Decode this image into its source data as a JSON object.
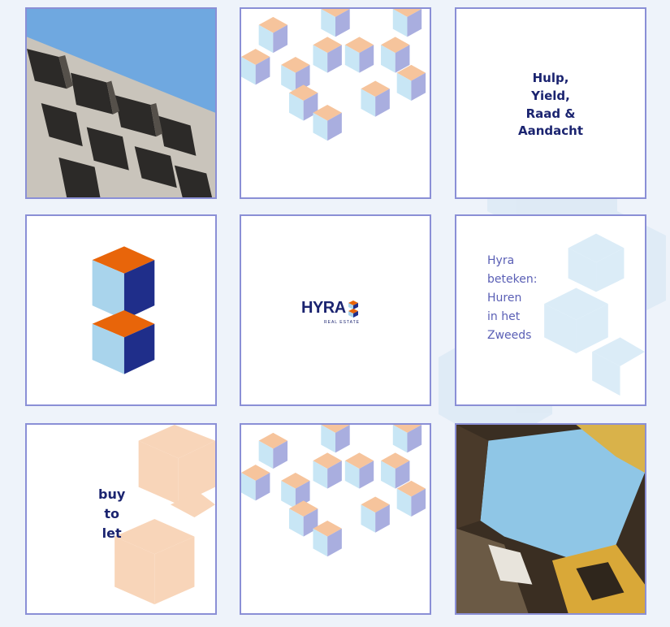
{
  "tiles": {
    "t3_lines": [
      "Hulp,",
      "Yield,",
      "Raad &",
      "Aandacht"
    ],
    "t5_logo": "HYRA",
    "t5_logo_sub": "REAL ESTATE",
    "t6_lines": [
      "Hyra",
      "beteken:",
      "Huren",
      "in het",
      "Zweeds"
    ],
    "t7_lines": [
      "buy",
      "to",
      "let"
    ]
  },
  "colors": {
    "navy": "#1b2470",
    "orange": "#e8650a",
    "light_blue": "#a9d4ec",
    "peach": "#f6c49c",
    "lavender": "#a9aedf",
    "tile_border": "#8a8fd6"
  }
}
